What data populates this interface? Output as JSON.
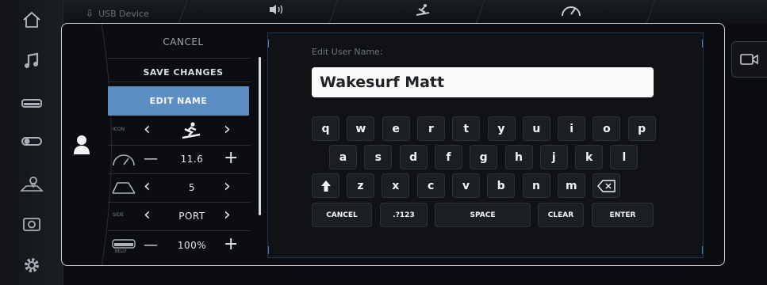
{
  "topbar": {
    "usb_label": "USB Device"
  },
  "rail": {
    "items": [
      "home-icon",
      "music-icon",
      "ballast-icon",
      "wake-shaper-icon",
      "map-pin-icon",
      "camera-icon",
      "gear-icon"
    ]
  },
  "profile": {
    "cancel": "CANCEL",
    "save_changes": "SAVE CHANGES",
    "edit_name": "EDIT NAME",
    "icon_label": "ICON",
    "speed_value": "11.6",
    "wedge_value": "5",
    "side_label": "SIDE",
    "side_value": "PORT",
    "belly_label": "BELLY",
    "belly_value": "100%",
    "prev_arrow": "‹",
    "next_arrow": "›",
    "minus": "—",
    "plus": "+"
  },
  "keyboard": {
    "field_label": "Edit User Name:",
    "field_value": "Wakesurf Matt",
    "row1": [
      "q",
      "w",
      "e",
      "r",
      "t",
      "y",
      "u",
      "i",
      "o",
      "p"
    ],
    "row2": [
      "a",
      "s",
      "d",
      "f",
      "g",
      "h",
      "j",
      "k",
      "l"
    ],
    "row3": [
      "z",
      "x",
      "c",
      "v",
      "b",
      "n",
      "m"
    ],
    "cancel": "CANCEL",
    "numbers": ".?123",
    "space": "SPACE",
    "clear": "CLEAR",
    "enter": "ENTER"
  },
  "colors": {
    "accent": "#5c8ec4",
    "border": "#cfd3d8",
    "panel_edge": "#4a7fc0"
  }
}
